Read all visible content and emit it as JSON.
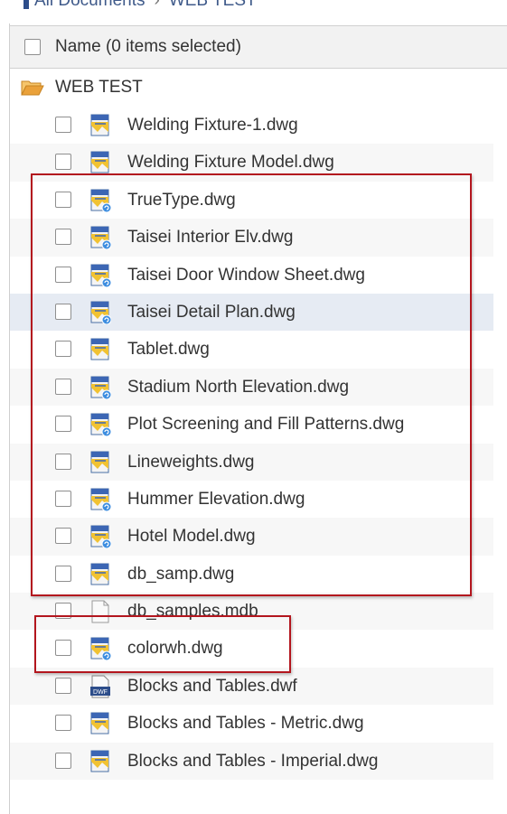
{
  "breadcrumb": {
    "root": "All Documents",
    "current": "WEB TEST"
  },
  "header": {
    "name_label": "Name (0 items selected)"
  },
  "root_folder": {
    "label": "WEB TEST",
    "icon": "folder-open-icon",
    "color": "#e8a13a"
  },
  "files": [
    {
      "name": "Welding Fixture-1.dwg",
      "icon": "dwg-file-icon"
    },
    {
      "name": "Welding Fixture Model.dwg",
      "icon": "dwg-file-icon"
    },
    {
      "name": "TrueType.dwg",
      "icon": "dwg-xref-file-icon"
    },
    {
      "name": "Taisei Interior Elv.dwg",
      "icon": "dwg-xref-file-icon"
    },
    {
      "name": "Taisei Door Window Sheet.dwg",
      "icon": "dwg-xref-file-icon"
    },
    {
      "name": "Taisei Detail Plan.dwg",
      "icon": "dwg-xref-file-icon"
    },
    {
      "name": "Tablet.dwg",
      "icon": "dwg-file-icon"
    },
    {
      "name": "Stadium North Elevation.dwg",
      "icon": "dwg-xref-file-icon"
    },
    {
      "name": "Plot Screening and Fill Patterns.dwg",
      "icon": "dwg-xref-file-icon"
    },
    {
      "name": "Lineweights.dwg",
      "icon": "dwg-file-icon"
    },
    {
      "name": "Hummer Elevation.dwg",
      "icon": "dwg-xref-file-icon"
    },
    {
      "name": "Hotel Model.dwg",
      "icon": "dwg-xref-file-icon"
    },
    {
      "name": "db_samp.dwg",
      "icon": "dwg-file-icon"
    },
    {
      "name": "db_samples.mdb",
      "icon": "generic-file-icon"
    },
    {
      "name": "colorwh.dwg",
      "icon": "dwg-xref-file-icon"
    },
    {
      "name": "Blocks and Tables.dwf",
      "icon": "dwf-file-icon",
      "badge": "DWF"
    },
    {
      "name": "Blocks and Tables - Metric.dwg",
      "icon": "dwg-file-icon"
    },
    {
      "name": "Blocks and Tables - Imperial.dwg",
      "icon": "dwg-file-icon"
    }
  ],
  "colors": {
    "highlight": "#b3161e",
    "selected_row": "#e6ebf3",
    "accent": "#2d4d8a"
  }
}
